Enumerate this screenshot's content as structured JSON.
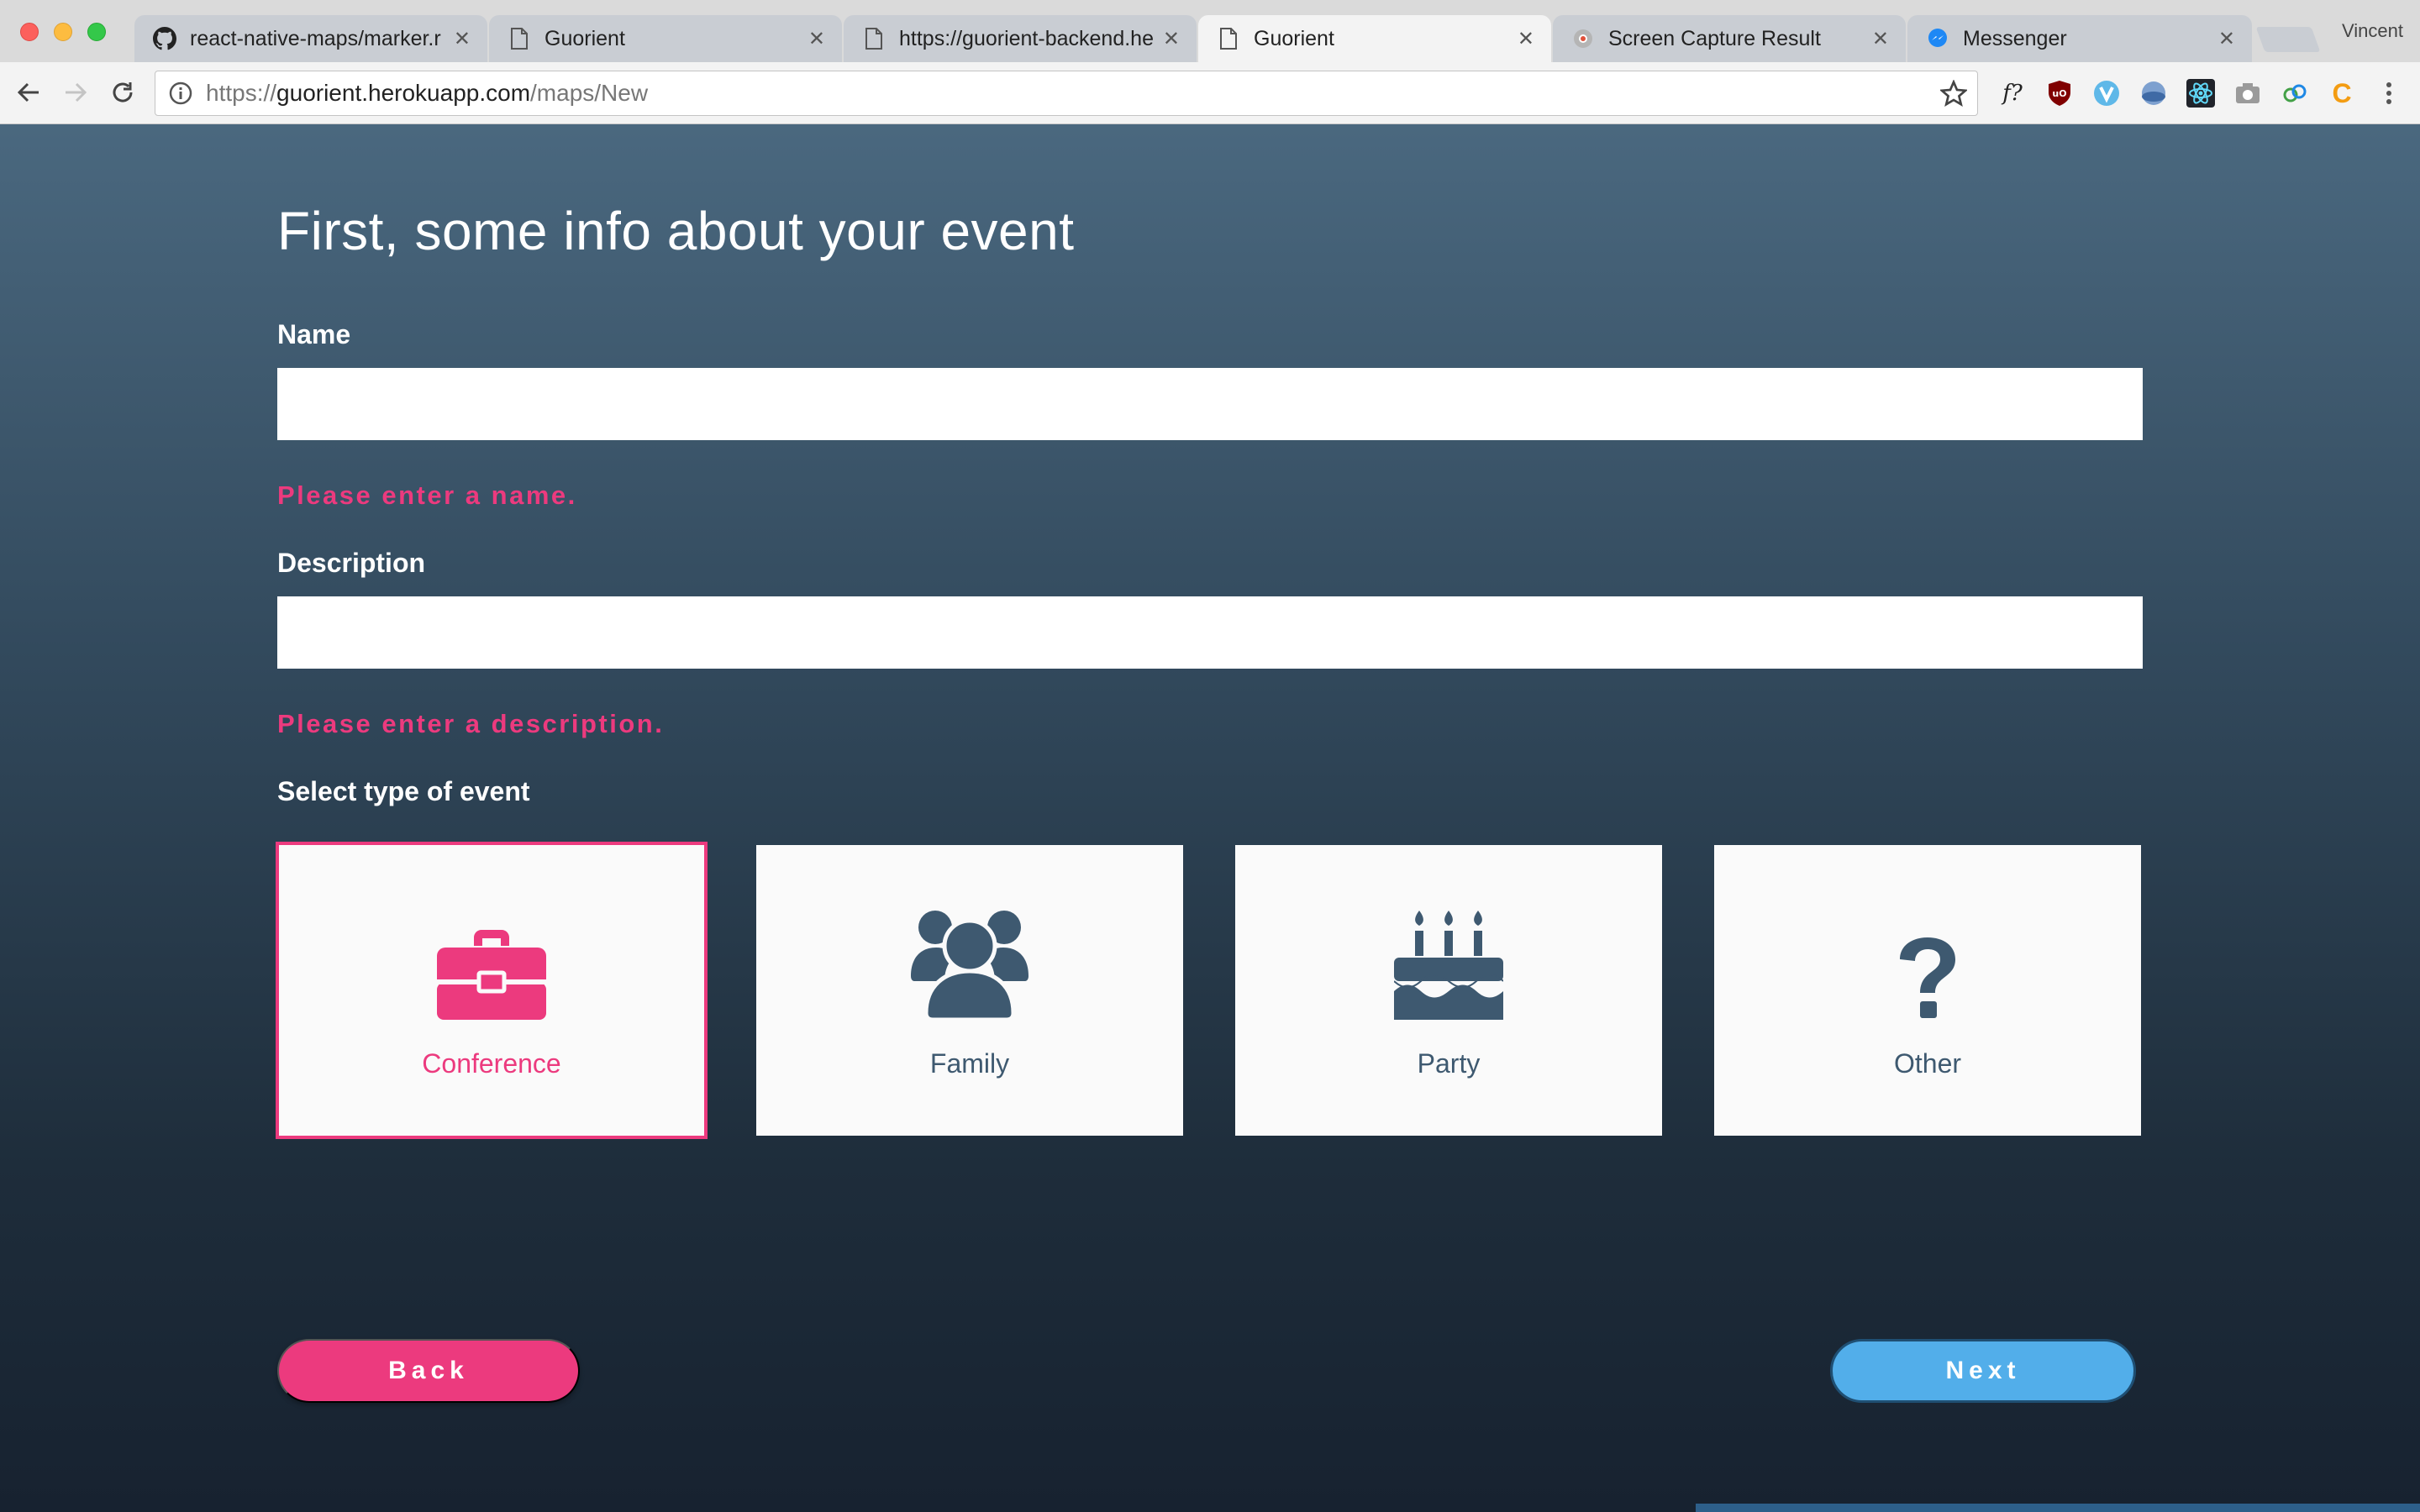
{
  "browser": {
    "tabs": [
      {
        "title": "react-native-maps/marker.r",
        "icon": "github-icon",
        "active": false
      },
      {
        "title": "Guorient",
        "icon": "document-icon",
        "active": false
      },
      {
        "title": "https://guorient-backend.he",
        "icon": "document-icon",
        "active": false
      },
      {
        "title": "Guorient",
        "icon": "document-icon",
        "active": true
      },
      {
        "title": "Screen Capture Result",
        "icon": "screen-capture-icon",
        "active": false
      },
      {
        "title": "Messenger",
        "icon": "messenger-icon",
        "active": false
      }
    ],
    "profile_name": "Vincent",
    "url_host_prefix": "https://",
    "url_host": "guorient.herokuapp.com",
    "url_path": "/maps/New",
    "extensions": [
      "font-query-icon",
      "ublock-icon",
      "vimium-icon",
      "globe-icon",
      "react-devtools-icon",
      "camera-icon",
      "link-extension-icon",
      "c-extension-icon"
    ],
    "extension_labels": {
      "font_query": "f?",
      "c_extension": "C"
    }
  },
  "form": {
    "heading": "First, some info about your event",
    "name": {
      "label": "Name",
      "value": "",
      "error": "Please enter a name."
    },
    "description": {
      "label": "Description",
      "value": "",
      "error": "Please enter a description."
    },
    "event_type": {
      "label": "Select type of event",
      "selected": "Conference",
      "options": [
        {
          "label": "Conference",
          "icon": "briefcase-icon"
        },
        {
          "label": "Family",
          "icon": "family-icon"
        },
        {
          "label": "Party",
          "icon": "birthday-cake-icon"
        },
        {
          "label": "Other",
          "icon": "question-mark-icon"
        }
      ]
    },
    "back_label": "Back",
    "next_label": "Next"
  },
  "colors": {
    "accent_pink": "#ec3a7e",
    "accent_blue": "#52aeea",
    "icon_slate": "#3e5970",
    "background_top": "#4a687f",
    "background_bottom": "#172230"
  }
}
